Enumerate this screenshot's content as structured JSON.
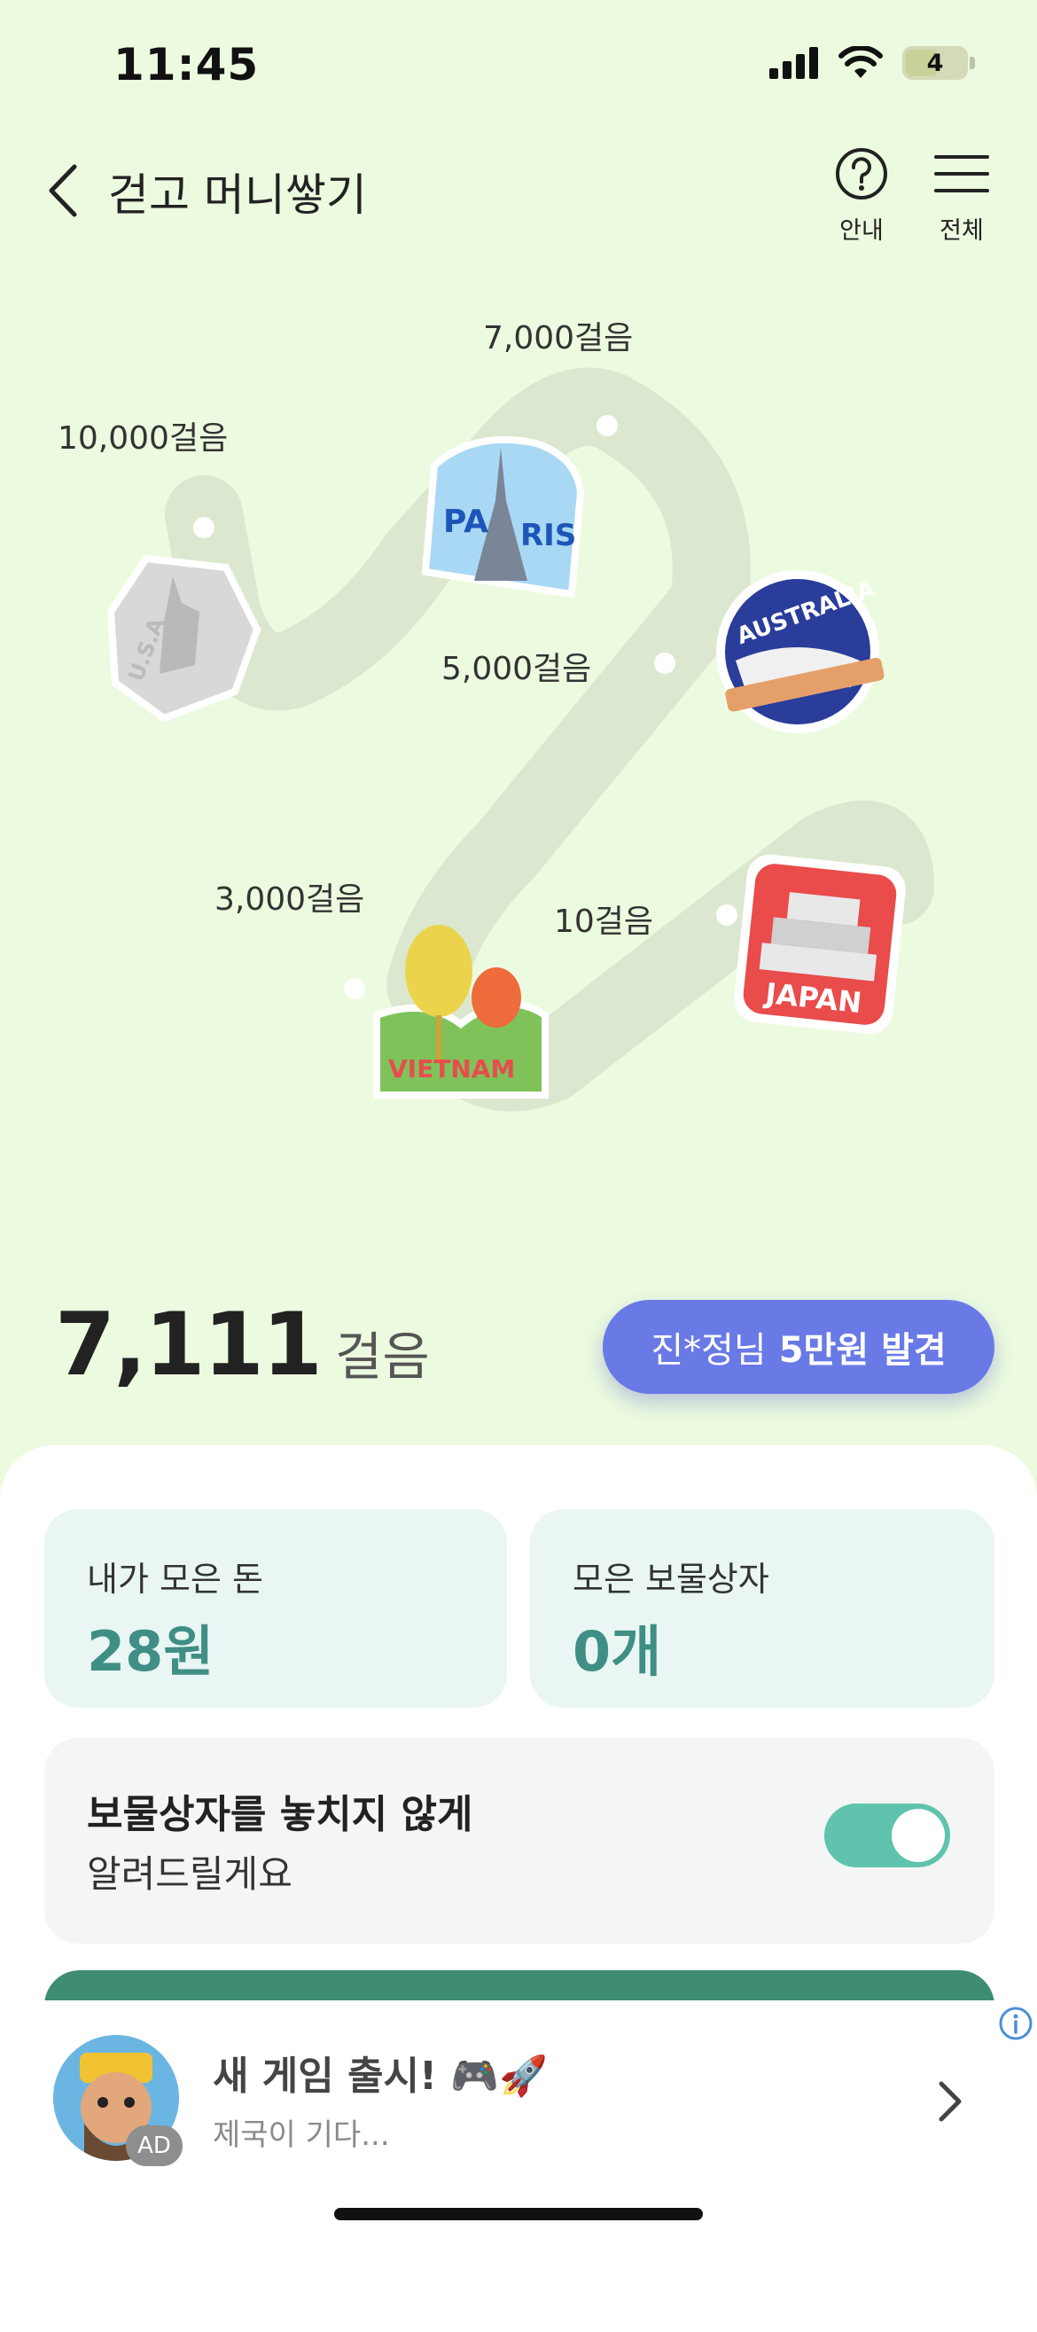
{
  "status_bar": {
    "time": "11:45",
    "battery": "4"
  },
  "header": {
    "title": "걷고 머니쌓기",
    "help_label": "안내",
    "menu_label": "전체"
  },
  "map": {
    "milestones": [
      {
        "label": "10걸음",
        "badge": "JAPAN",
        "achieved": true
      },
      {
        "label": "3,000걸음",
        "badge": "VIETNAM",
        "achieved": true
      },
      {
        "label": "5,000걸음",
        "badge": "AUSTRALIA",
        "achieved": true
      },
      {
        "label": "7,000걸음",
        "badge": "PARIS",
        "achieved": true
      },
      {
        "label": "10,000걸음",
        "badge": "U.S.A",
        "achieved": false
      }
    ]
  },
  "steps": {
    "value": "7,111",
    "unit": "걸음"
  },
  "found_banner": {
    "name": "진*정님",
    "amount": "5만원 발견"
  },
  "cards": {
    "money": {
      "label": "내가 모은 돈",
      "value": "28원"
    },
    "chests": {
      "label": "모은 보물상자",
      "value": "0개"
    }
  },
  "notify": {
    "title": "보물상자를 놓치지 않게",
    "subtitle": "알려드릴게요",
    "enabled": true
  },
  "ad": {
    "title": "새 게임 출시! 🎮🚀",
    "subtitle": "제국이 기다...",
    "badge": "AD"
  },
  "colors": {
    "background": "#ecfadf",
    "accent": "#6979e6",
    "teal": "#3f8f85",
    "toggle": "#5fc3ad"
  }
}
